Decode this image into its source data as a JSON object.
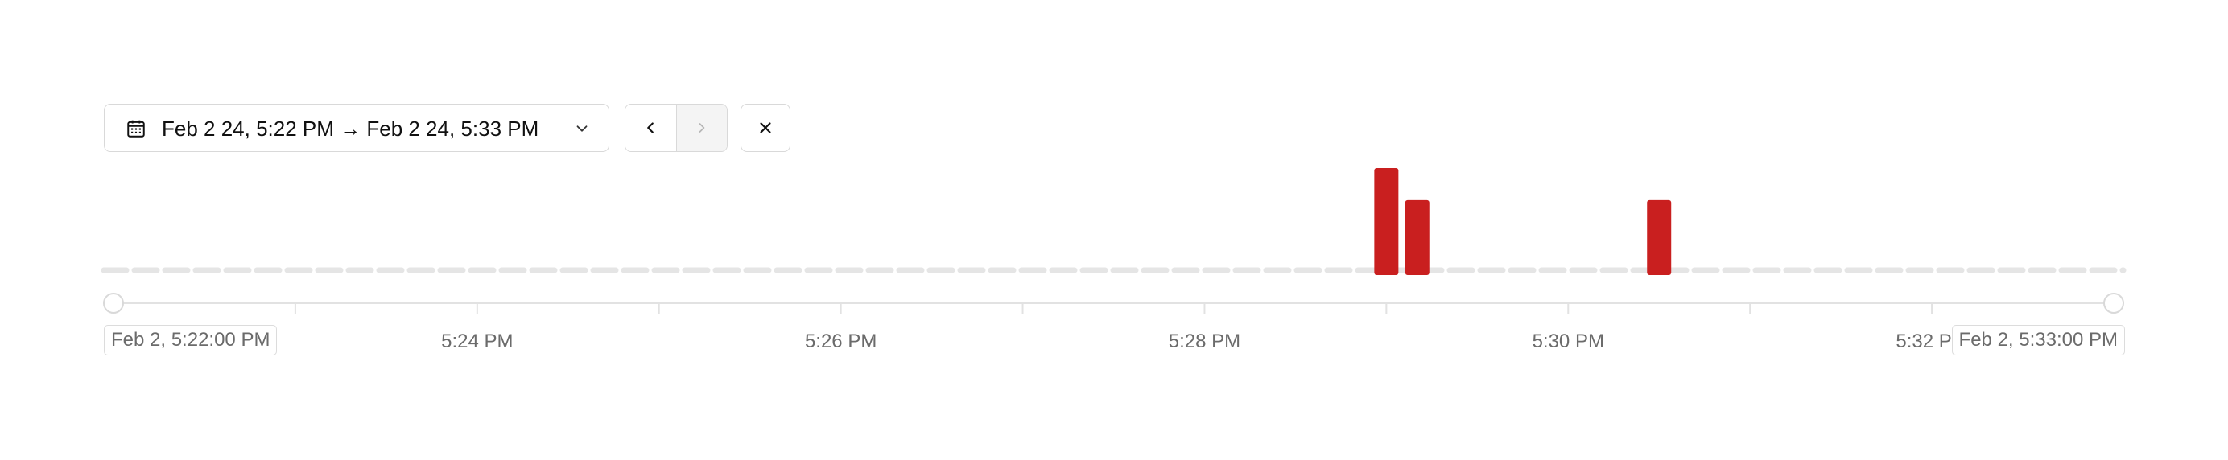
{
  "toolbar": {
    "range_label": "Feb 2 24, 5:22 PM → Feb 2 24, 5:33 PM",
    "icons": {
      "calendar": "calendar-icon",
      "dropdown": "chevron-down-icon",
      "prev": "chevron-left-icon",
      "next": "chevron-right-icon",
      "close": "close-icon"
    },
    "next_disabled": true
  },
  "timeline": {
    "start_label": "Feb 2, 5:22:00 PM",
    "end_label": "Feb 2, 5:33:00 PM"
  },
  "chart_data": {
    "type": "bar",
    "x_range_minutes": [
      "5:22 PM",
      "5:33 PM"
    ],
    "tick_labels": [
      "5:24 PM",
      "5:26 PM",
      "5:28 PM",
      "5:30 PM",
      "5:32 PM"
    ],
    "tick_minutes": [
      2,
      4,
      6,
      8,
      10
    ],
    "minor_tick_minutes": [
      1,
      3,
      5,
      7,
      9
    ],
    "bars": [
      {
        "x_minutes": 7.0,
        "value": 1.0
      },
      {
        "x_minutes": 7.17,
        "value": 0.7
      },
      {
        "x_minutes": 8.5,
        "value": 0.7
      }
    ],
    "ylim": [
      0,
      1
    ],
    "colors": {
      "bar": "#c91f1f",
      "baseline_dash": "#e5e5e5",
      "axis": "#e2e2e2",
      "tick_text": "#6b6b6b"
    }
  }
}
